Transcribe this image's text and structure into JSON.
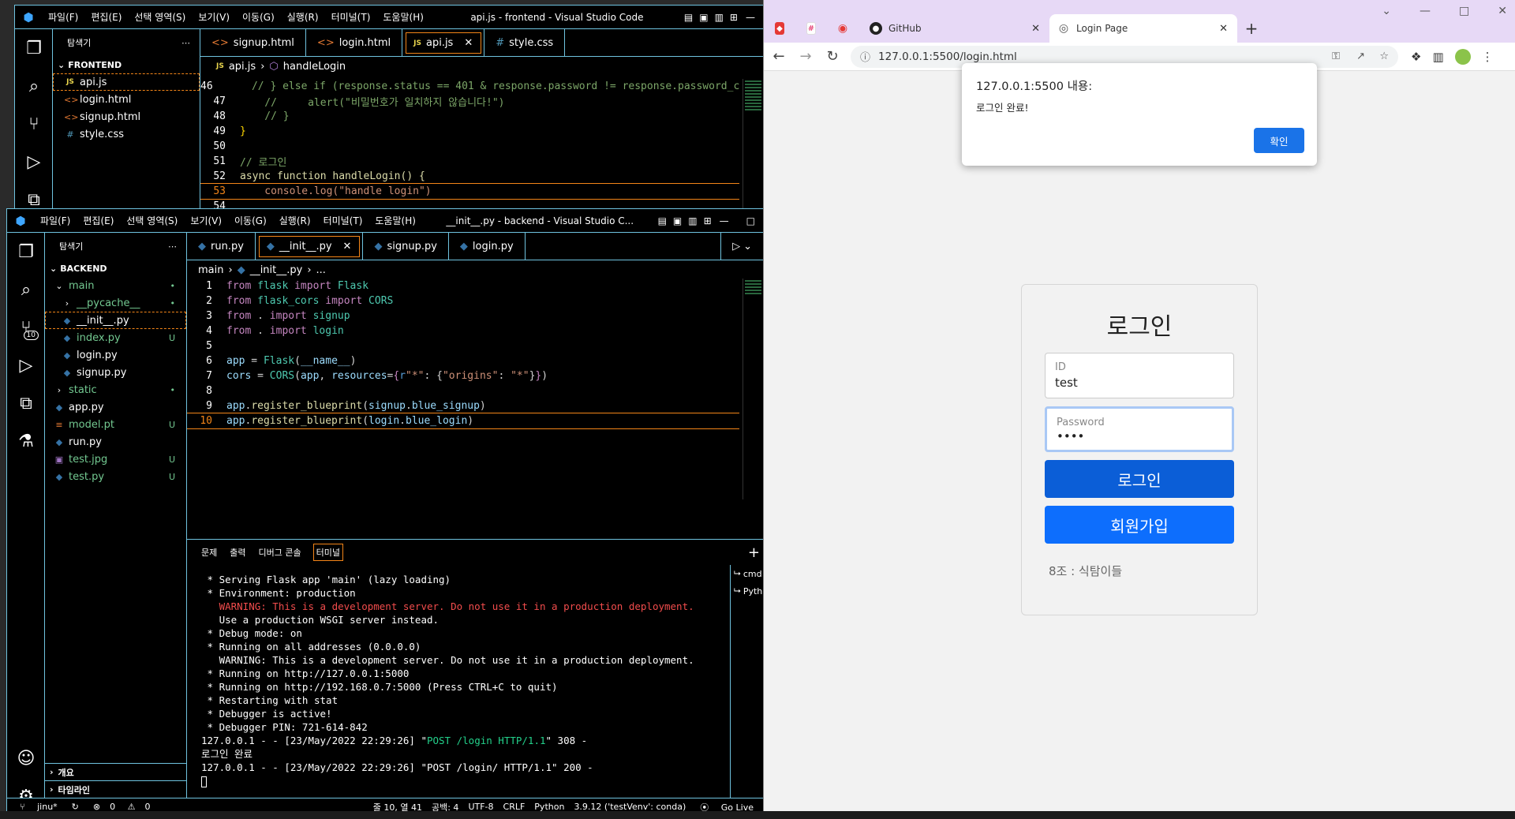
{
  "vscode_top": {
    "menu": [
      "파일(F)",
      "편집(E)",
      "선택 영역(S)",
      "보기(V)",
      "이동(G)",
      "실행(R)",
      "터미널(T)",
      "도움말(H)"
    ],
    "title": "api.js - frontend - Visual Studio Code",
    "explorer_label": "탐색기",
    "section": "FRONTEND",
    "files": [
      "api.js",
      "login.html",
      "signup.html",
      "style.css"
    ],
    "tabs": [
      "signup.html",
      "login.html",
      "api.js",
      "style.css"
    ],
    "breadcrumb": [
      "api.js",
      "handleLogin"
    ],
    "lines": [
      {
        "n": "46",
        "text": "    // } else if (response.status == 401 & response.password != response.password_c"
      },
      {
        "n": "47",
        "text": "    //     alert(\"비밀번호가 일치하지 않습니다!\")"
      },
      {
        "n": "48",
        "text": "    // }"
      },
      {
        "n": "49",
        "text": "}"
      },
      {
        "n": "50",
        "text": ""
      },
      {
        "n": "51",
        "text": "// 로그인"
      },
      {
        "n": "52",
        "text": "async function handleLogin() {"
      },
      {
        "n": "53",
        "text": "    console.log(\"handle login\")"
      },
      {
        "n": "54",
        "text": ""
      }
    ]
  },
  "vscode_bottom": {
    "menu": [
      "파일(F)",
      "편집(E)",
      "선택 영역(S)",
      "보기(V)",
      "이동(G)",
      "실행(R)",
      "터미널(T)",
      "도움말(H)"
    ],
    "title": "__init__.py - backend - Visual Studio C...",
    "explorer_label": "탐색기",
    "section": "BACKEND",
    "tree": [
      {
        "label": "main",
        "type": "folder-open",
        "indent": 1,
        "stat": "•"
      },
      {
        "label": "__pycache__",
        "type": "folder",
        "indent": 2,
        "stat": "•"
      },
      {
        "label": "__init__.py",
        "type": "py",
        "indent": 2,
        "stat": ""
      },
      {
        "label": "index.py",
        "type": "py",
        "indent": 2,
        "stat": "U"
      },
      {
        "label": "login.py",
        "type": "py",
        "indent": 2,
        "stat": ""
      },
      {
        "label": "signup.py",
        "type": "py",
        "indent": 2,
        "stat": ""
      },
      {
        "label": "static",
        "type": "folder",
        "indent": 1,
        "stat": "•"
      },
      {
        "label": "app.py",
        "type": "py",
        "indent": 1,
        "stat": ""
      },
      {
        "label": "model.pt",
        "type": "rss",
        "indent": 1,
        "stat": "U"
      },
      {
        "label": "run.py",
        "type": "py",
        "indent": 1,
        "stat": ""
      },
      {
        "label": "test.jpg",
        "type": "img",
        "indent": 1,
        "stat": "U"
      },
      {
        "label": "test.py",
        "type": "py",
        "indent": 1,
        "stat": "U"
      }
    ],
    "outline": "개요",
    "timeline": "타임라인",
    "tabs": [
      "run.py",
      "__init__.py",
      "signup.py",
      "login.py"
    ],
    "breadcrumb": [
      "main",
      "__init__.py",
      "..."
    ],
    "code": [
      "from flask import Flask",
      "from flask_cors import CORS",
      "from . import signup",
      "from . import login",
      "",
      "app = Flask(__name__)",
      "cors = CORS(app, resources={r\"*\": {\"origins\": \"*\"}})",
      "",
      "app.register_blueprint(signup.blue_signup)",
      "app.register_blueprint(login.blue_login)"
    ],
    "panel_tabs": [
      "문제",
      "출력",
      "디버그 콘솔",
      "터미널"
    ],
    "terminal": [
      " * Serving Flask app 'main' (lazy loading)",
      " * Environment: production",
      "   WARNING: This is a development server. Do not use it in a production deployment.",
      "   Use a production WSGI server instead.",
      " * Debug mode: on",
      " * Running on all addresses (0.0.0.0)",
      "   WARNING: This is a development server. Do not use it in a production deployment.",
      " * Running on http://127.0.0.1:5000",
      " * Running on http://192.168.0.7:5000 (Press CTRL+C to quit)",
      " * Restarting with stat",
      " * Debugger is active!",
      " * Debugger PIN: 721-614-842",
      "127.0.0.1 - - [23/May/2022 22:29:26] \"POST /login HTTP/1.1\" 308 -",
      "로그인 완료",
      "127.0.0.1 - - [23/May/2022 22:29:26] \"POST /login/ HTTP/1.1\" 200 -"
    ],
    "terminal_list": [
      "cmd",
      "Pyth"
    ],
    "status": {
      "branch": "jinu*",
      "errors": "0",
      "warnings": "0",
      "position": "줄 10, 열 41",
      "spaces": "공백: 4",
      "encoding": "UTF-8",
      "eol": "CRLF",
      "language": "Python",
      "interpreter": "3.9.12 ('testVenv': conda)",
      "golive": "Go Live"
    }
  },
  "chrome": {
    "tabs": [
      {
        "label": "",
        "icon": "red-square-icon"
      },
      {
        "label": "",
        "icon": "slack-icon"
      },
      {
        "label": "",
        "icon": "record-icon"
      },
      {
        "label": "GitHub",
        "icon": "github-icon"
      },
      {
        "label": "Login Page",
        "icon": "globe-icon"
      }
    ],
    "url": "127.0.0.1:5500/login.html",
    "dialog": {
      "title": "127.0.0.1:5500 내용:",
      "message": "로그인 완료!",
      "ok": "확인"
    },
    "page": {
      "heading": "로그인",
      "id_label": "ID",
      "id_value": "test",
      "pw_label": "Password",
      "pw_value": "••••",
      "login_button": "로그인",
      "signup_button": "회원가입",
      "footer": "8조 : 식탐이들"
    }
  },
  "colors": {
    "hc_border": "#6fc3df",
    "focus_orange": "#f38518",
    "primary_button": "#0d6efd",
    "chrome_tabbar": "#e7d9f6"
  }
}
